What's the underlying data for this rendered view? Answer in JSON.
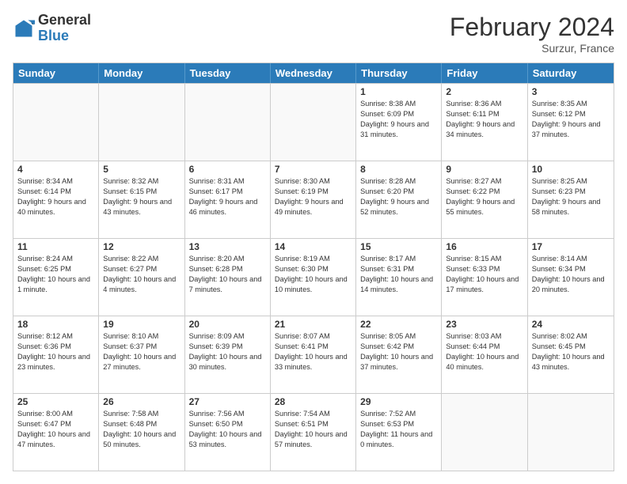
{
  "logo": {
    "general": "General",
    "blue": "Blue"
  },
  "header": {
    "title": "February 2024",
    "subtitle": "Surzur, France"
  },
  "days_of_week": [
    "Sunday",
    "Monday",
    "Tuesday",
    "Wednesday",
    "Thursday",
    "Friday",
    "Saturday"
  ],
  "weeks": [
    [
      {
        "day": "",
        "empty": true
      },
      {
        "day": "",
        "empty": true
      },
      {
        "day": "",
        "empty": true
      },
      {
        "day": "",
        "empty": true
      },
      {
        "day": "1",
        "info": "Sunrise: 8:38 AM\nSunset: 6:09 PM\nDaylight: 9 hours and 31 minutes."
      },
      {
        "day": "2",
        "info": "Sunrise: 8:36 AM\nSunset: 6:11 PM\nDaylight: 9 hours and 34 minutes."
      },
      {
        "day": "3",
        "info": "Sunrise: 8:35 AM\nSunset: 6:12 PM\nDaylight: 9 hours and 37 minutes."
      }
    ],
    [
      {
        "day": "4",
        "info": "Sunrise: 8:34 AM\nSunset: 6:14 PM\nDaylight: 9 hours and 40 minutes."
      },
      {
        "day": "5",
        "info": "Sunrise: 8:32 AM\nSunset: 6:15 PM\nDaylight: 9 hours and 43 minutes."
      },
      {
        "day": "6",
        "info": "Sunrise: 8:31 AM\nSunset: 6:17 PM\nDaylight: 9 hours and 46 minutes."
      },
      {
        "day": "7",
        "info": "Sunrise: 8:30 AM\nSunset: 6:19 PM\nDaylight: 9 hours and 49 minutes."
      },
      {
        "day": "8",
        "info": "Sunrise: 8:28 AM\nSunset: 6:20 PM\nDaylight: 9 hours and 52 minutes."
      },
      {
        "day": "9",
        "info": "Sunrise: 8:27 AM\nSunset: 6:22 PM\nDaylight: 9 hours and 55 minutes."
      },
      {
        "day": "10",
        "info": "Sunrise: 8:25 AM\nSunset: 6:23 PM\nDaylight: 9 hours and 58 minutes."
      }
    ],
    [
      {
        "day": "11",
        "info": "Sunrise: 8:24 AM\nSunset: 6:25 PM\nDaylight: 10 hours and 1 minute."
      },
      {
        "day": "12",
        "info": "Sunrise: 8:22 AM\nSunset: 6:27 PM\nDaylight: 10 hours and 4 minutes."
      },
      {
        "day": "13",
        "info": "Sunrise: 8:20 AM\nSunset: 6:28 PM\nDaylight: 10 hours and 7 minutes."
      },
      {
        "day": "14",
        "info": "Sunrise: 8:19 AM\nSunset: 6:30 PM\nDaylight: 10 hours and 10 minutes."
      },
      {
        "day": "15",
        "info": "Sunrise: 8:17 AM\nSunset: 6:31 PM\nDaylight: 10 hours and 14 minutes."
      },
      {
        "day": "16",
        "info": "Sunrise: 8:15 AM\nSunset: 6:33 PM\nDaylight: 10 hours and 17 minutes."
      },
      {
        "day": "17",
        "info": "Sunrise: 8:14 AM\nSunset: 6:34 PM\nDaylight: 10 hours and 20 minutes."
      }
    ],
    [
      {
        "day": "18",
        "info": "Sunrise: 8:12 AM\nSunset: 6:36 PM\nDaylight: 10 hours and 23 minutes."
      },
      {
        "day": "19",
        "info": "Sunrise: 8:10 AM\nSunset: 6:37 PM\nDaylight: 10 hours and 27 minutes."
      },
      {
        "day": "20",
        "info": "Sunrise: 8:09 AM\nSunset: 6:39 PM\nDaylight: 10 hours and 30 minutes."
      },
      {
        "day": "21",
        "info": "Sunrise: 8:07 AM\nSunset: 6:41 PM\nDaylight: 10 hours and 33 minutes."
      },
      {
        "day": "22",
        "info": "Sunrise: 8:05 AM\nSunset: 6:42 PM\nDaylight: 10 hours and 37 minutes."
      },
      {
        "day": "23",
        "info": "Sunrise: 8:03 AM\nSunset: 6:44 PM\nDaylight: 10 hours and 40 minutes."
      },
      {
        "day": "24",
        "info": "Sunrise: 8:02 AM\nSunset: 6:45 PM\nDaylight: 10 hours and 43 minutes."
      }
    ],
    [
      {
        "day": "25",
        "info": "Sunrise: 8:00 AM\nSunset: 6:47 PM\nDaylight: 10 hours and 47 minutes."
      },
      {
        "day": "26",
        "info": "Sunrise: 7:58 AM\nSunset: 6:48 PM\nDaylight: 10 hours and 50 minutes."
      },
      {
        "day": "27",
        "info": "Sunrise: 7:56 AM\nSunset: 6:50 PM\nDaylight: 10 hours and 53 minutes."
      },
      {
        "day": "28",
        "info": "Sunrise: 7:54 AM\nSunset: 6:51 PM\nDaylight: 10 hours and 57 minutes."
      },
      {
        "day": "29",
        "info": "Sunrise: 7:52 AM\nSunset: 6:53 PM\nDaylight: 11 hours and 0 minutes."
      },
      {
        "day": "",
        "empty": true
      },
      {
        "day": "",
        "empty": true
      }
    ]
  ]
}
